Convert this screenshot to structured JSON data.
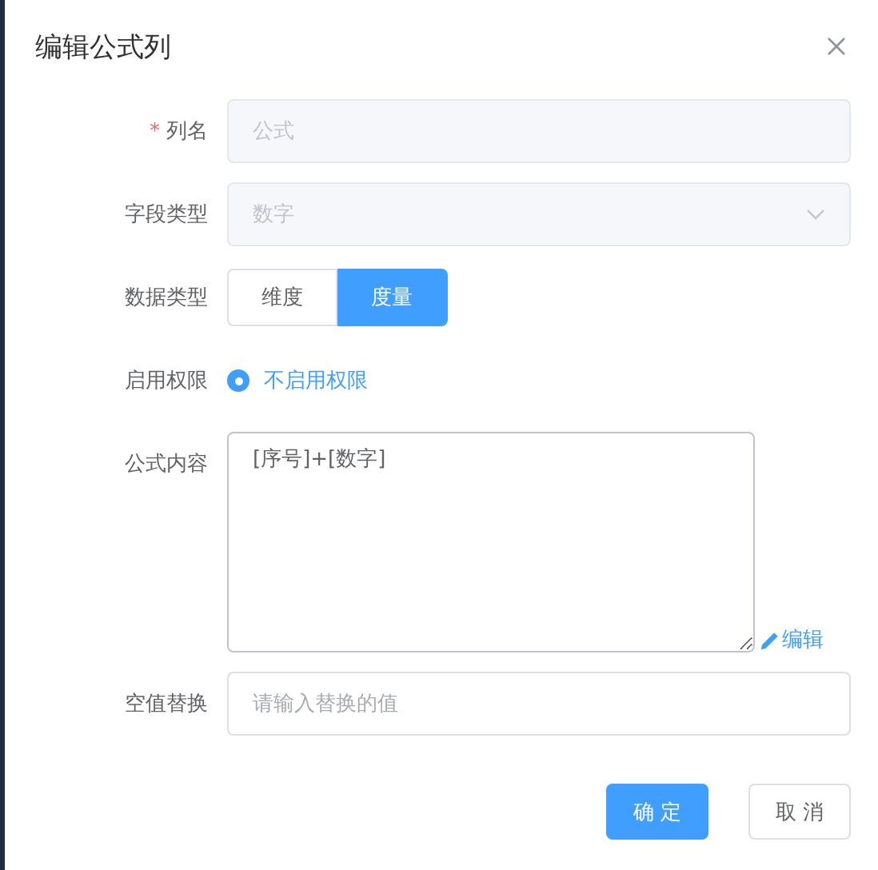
{
  "dialog": {
    "title": "编辑公式列"
  },
  "fields": [
    {
      "kind": "input",
      "label": "列名",
      "required_mark": "*",
      "placeholder": "公式",
      "disabled": true
    },
    {
      "kind": "select",
      "label": "字段类型",
      "placeholder": "数字",
      "disabled": true
    },
    {
      "kind": "segmented",
      "label": "数据类型",
      "options": [
        {
          "label": "维度",
          "selected": false
        },
        {
          "label": "度量",
          "selected": true
        }
      ]
    },
    {
      "kind": "radio",
      "label": "启用权限",
      "options": [
        {
          "label": "不启用权限",
          "selected": true
        }
      ]
    },
    {
      "kind": "textarea",
      "label": "公式内容",
      "value": "[序号]+[数字]",
      "link": "编辑"
    },
    {
      "kind": "input",
      "label": "空值替换",
      "placeholder": "请输入替换的值",
      "disabled": false
    }
  ],
  "buttons": [
    {
      "label": "确 定",
      "primary": true
    },
    {
      "label": "取 消",
      "primary": false
    }
  ]
}
